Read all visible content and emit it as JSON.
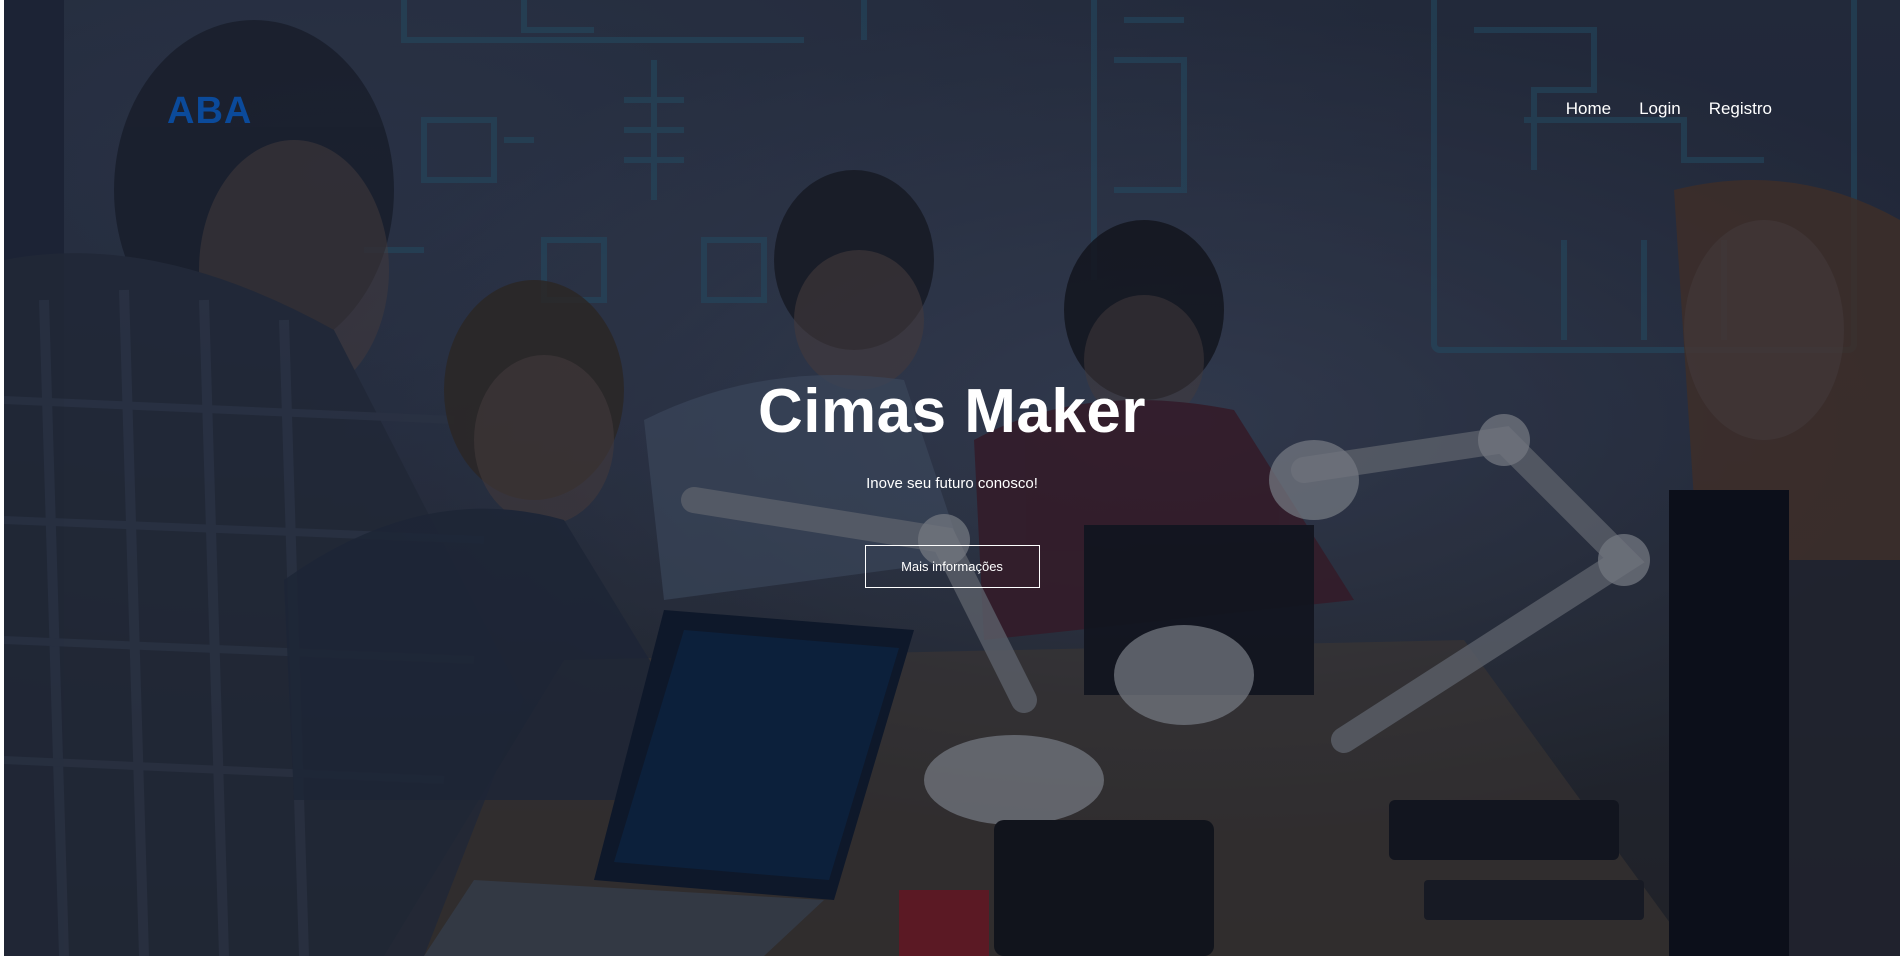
{
  "brand": {
    "logo_text": "ABA",
    "logo_color": "#0b4a9a"
  },
  "nav": {
    "items": [
      {
        "label": "Home"
      },
      {
        "label": "Login"
      },
      {
        "label": "Registro"
      }
    ]
  },
  "hero": {
    "title": "Cimas Maker",
    "subtitle": "Inove seu futuro conosco!",
    "cta_label": "Mais informações",
    "background_image": "photo of people working with laptops and robotic arms",
    "overlay_color": "#101626"
  }
}
